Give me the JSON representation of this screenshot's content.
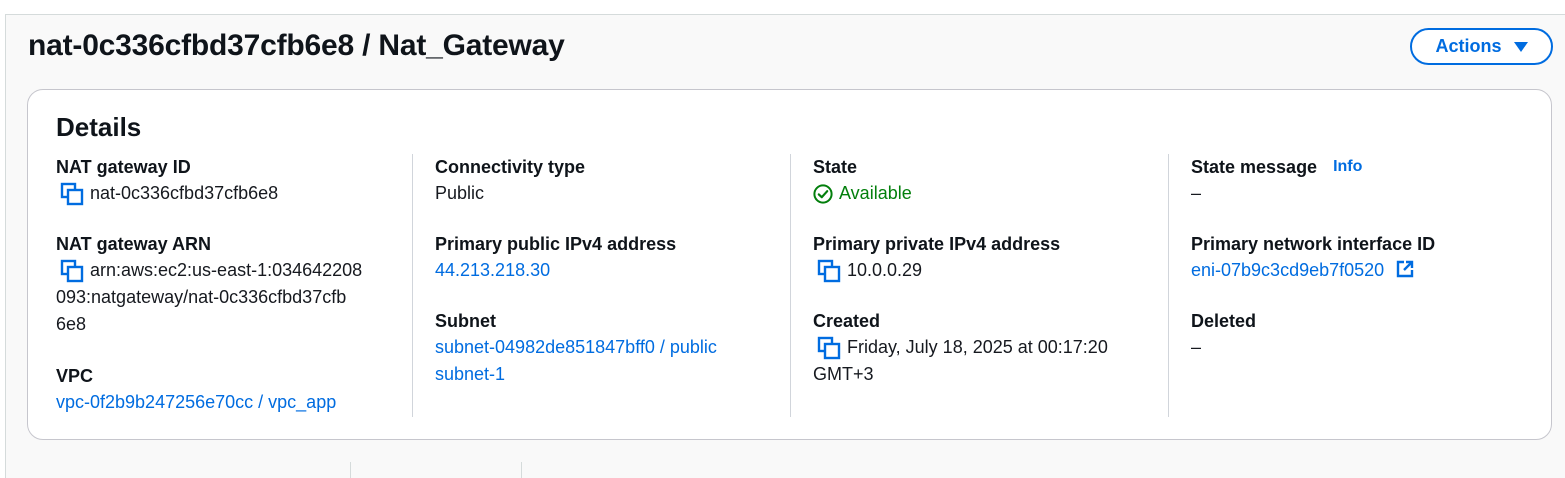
{
  "header": {
    "title": "nat-0c336cfbd37cfb6e8 / Nat_Gateway",
    "actions_label": "Actions"
  },
  "details": {
    "title": "Details",
    "nat_gateway_id": {
      "label": "NAT gateway ID",
      "value": "nat-0c336cfbd37cfb6e8"
    },
    "nat_gateway_arn": {
      "label": "NAT gateway ARN",
      "value_line1": "arn:aws:ec2:us-east-1:034642208",
      "value_line2": "093:natgateway/nat-0c336cfbd37cfb",
      "value_line3": "6e8"
    },
    "vpc": {
      "label": "VPC",
      "value": "vpc-0f2b9b247256e70cc / vpc_app"
    },
    "connectivity_type": {
      "label": "Connectivity type",
      "value": "Public"
    },
    "primary_public_ipv4": {
      "label": "Primary public IPv4 address",
      "value": "44.213.218.30"
    },
    "subnet": {
      "label": "Subnet",
      "value_line1": "subnet-04982de851847bff0 / public",
      "value_line2": "subnet-1"
    },
    "state": {
      "label": "State",
      "value": "Available"
    },
    "primary_private_ipv4": {
      "label": "Primary private IPv4 address",
      "value": "10.0.0.29"
    },
    "created": {
      "label": "Created",
      "value_line1": "Friday, July 18, 2025 at 00:17:20",
      "value_line2": "GMT+3"
    },
    "state_message": {
      "label": "State message",
      "info": "Info",
      "value": "–"
    },
    "primary_network_interface": {
      "label": "Primary network interface ID",
      "value": "eni-07b9c3cd9eb7f0520"
    },
    "deleted": {
      "label": "Deleted",
      "value": "–"
    }
  },
  "colors": {
    "link": "#006ce0",
    "success": "#037f0c",
    "border": "#c6c6cd"
  },
  "icons": [
    "copy-icon",
    "status-available-icon",
    "external-link-icon",
    "caret-down-icon"
  ]
}
